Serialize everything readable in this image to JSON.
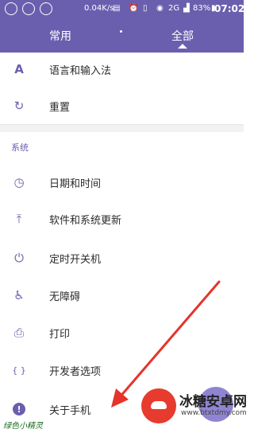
{
  "status_bar": {
    "speed": "0.04K/s",
    "network": "2G",
    "battery": "83%",
    "time": "07:02"
  },
  "tabs": [
    {
      "label": "常用",
      "selected": false
    },
    {
      "label": "全部",
      "selected": true
    }
  ],
  "items_top": [
    {
      "icon": "language-icon",
      "glyph": "A",
      "label": "语言和输入法"
    },
    {
      "icon": "reset-icon",
      "glyph": "↻",
      "label": "重置"
    }
  ],
  "section_header": "系统",
  "items_system": [
    {
      "icon": "clock-icon",
      "glyph": "◷",
      "label": "日期和时间"
    },
    {
      "icon": "update-icon",
      "glyph": "⤒",
      "label": "软件和系统更新"
    },
    {
      "icon": "power-icon",
      "glyph": "⏻",
      "label": "定时开关机"
    },
    {
      "icon": "accessibility-icon",
      "glyph": "♿",
      "label": "无障碍"
    },
    {
      "icon": "print-icon",
      "glyph": "⎙",
      "label": "打印"
    },
    {
      "icon": "developer-icon",
      "glyph": "{ }",
      "label": "开发者选项"
    },
    {
      "icon": "info-icon",
      "glyph": "!",
      "label": "关于手机"
    }
  ],
  "watermark": {
    "title": "冰糖安卓网",
    "url": "www.btxtdmy.com"
  },
  "signature": "绿色小精灵"
}
